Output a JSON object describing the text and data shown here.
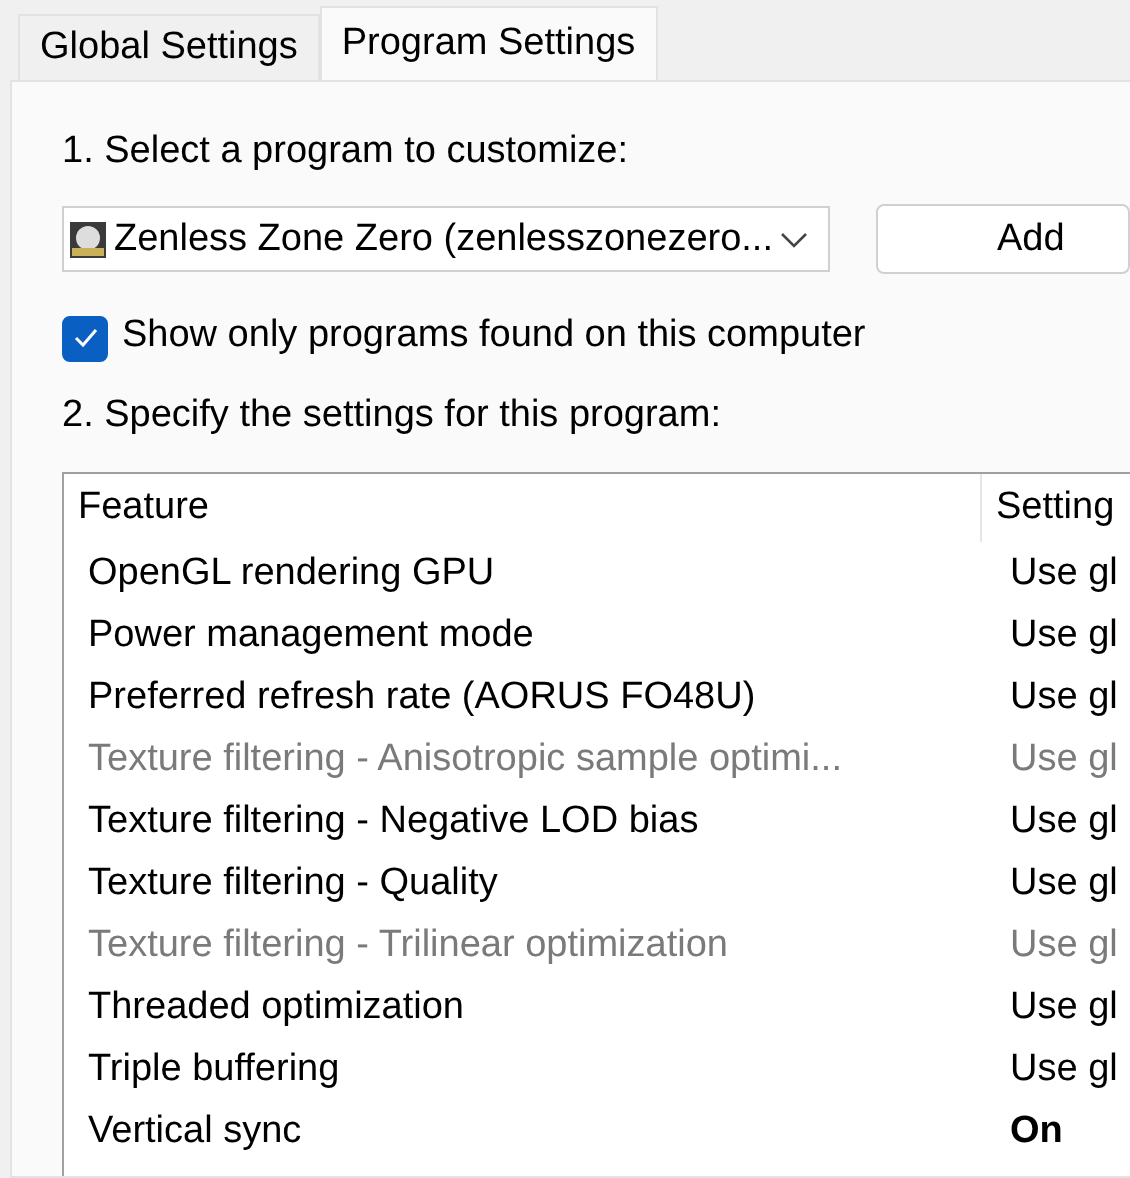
{
  "tabs": [
    {
      "label": "Global Settings",
      "selected": false
    },
    {
      "label": "Program Settings",
      "selected": true
    }
  ],
  "step_1": "1. Select a program to customize:",
  "program_select": {
    "value": "Zenless Zone Zero (zenlesszonezero..."
  },
  "add_button": "Add",
  "show_only_found": {
    "label": "Show only programs found on this computer",
    "checked": true
  },
  "step_2": "2. Specify the settings for this program:",
  "table": {
    "columns": [
      "Feature",
      "Setting"
    ],
    "rows": [
      {
        "feature": "OpenGL rendering GPU",
        "setting": "Use gl",
        "disabled": false,
        "modified": false
      },
      {
        "feature": "Power management mode",
        "setting": "Use gl",
        "disabled": false,
        "modified": false
      },
      {
        "feature": "Preferred refresh rate (AORUS FO48U)",
        "setting": "Use gl",
        "disabled": false,
        "modified": false
      },
      {
        "feature": "Texture filtering - Anisotropic sample optimi...",
        "setting": "Use gl",
        "disabled": true,
        "modified": false
      },
      {
        "feature": "Texture filtering - Negative LOD bias",
        "setting": "Use gl",
        "disabled": false,
        "modified": false
      },
      {
        "feature": "Texture filtering - Quality",
        "setting": "Use gl",
        "disabled": false,
        "modified": false
      },
      {
        "feature": "Texture filtering - Trilinear optimization",
        "setting": "Use gl",
        "disabled": true,
        "modified": false
      },
      {
        "feature": "Threaded optimization",
        "setting": "Use gl",
        "disabled": false,
        "modified": false
      },
      {
        "feature": "Triple buffering",
        "setting": "Use gl",
        "disabled": false,
        "modified": false
      },
      {
        "feature": "Vertical sync",
        "setting": "On",
        "disabled": false,
        "modified": true
      }
    ]
  }
}
